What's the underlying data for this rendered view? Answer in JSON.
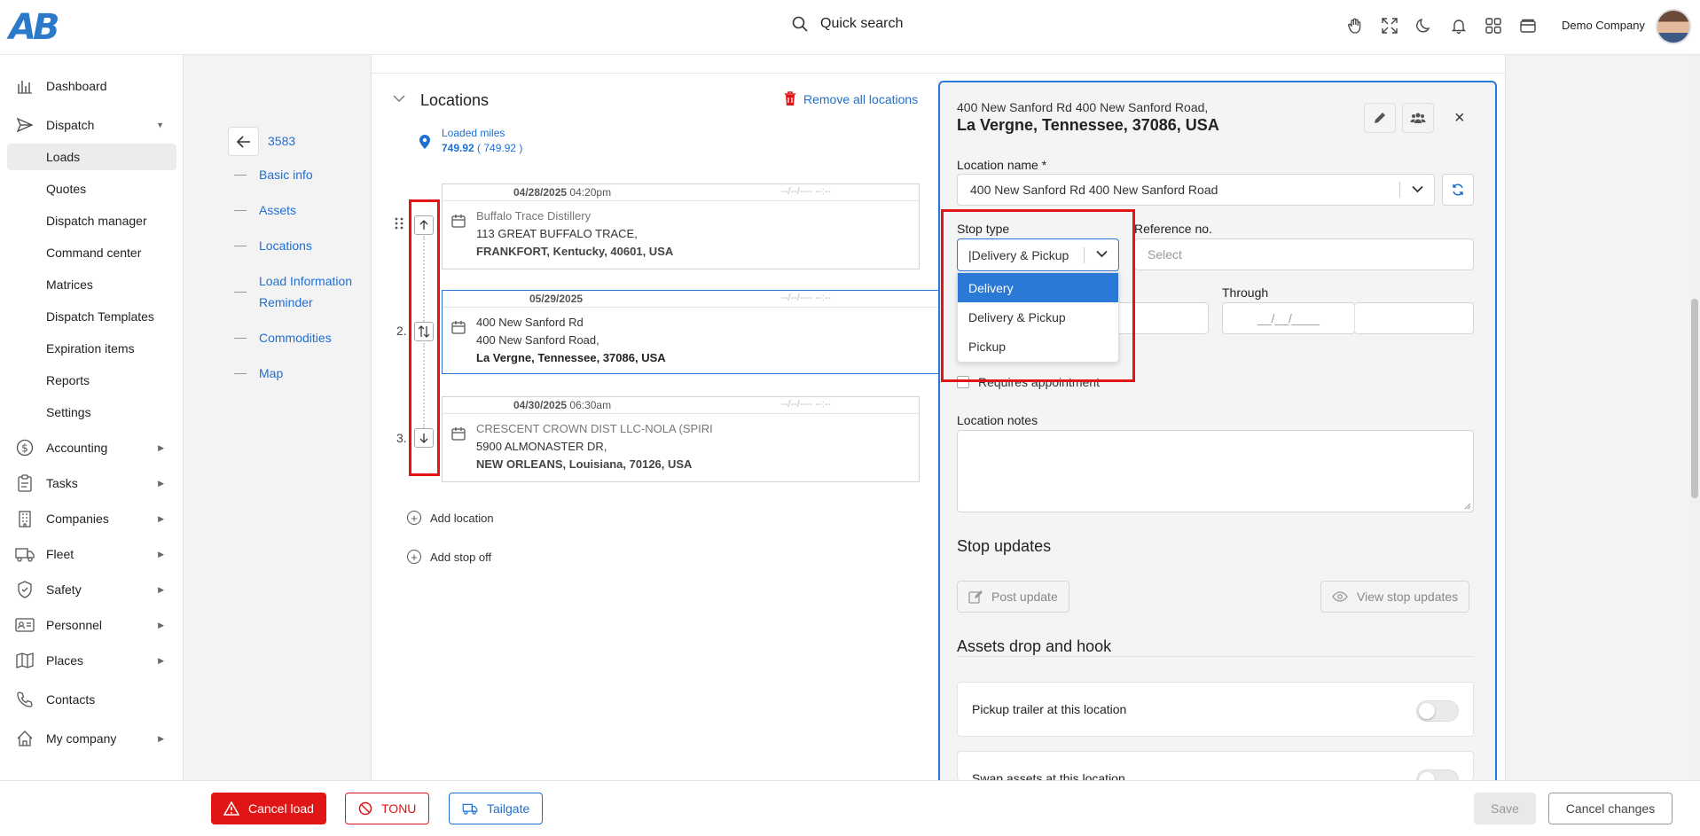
{
  "brand": {
    "logo_text": "AB",
    "accent": "#2b79d6",
    "danger": "#e01515"
  },
  "header": {
    "search_label": "Quick search",
    "company": "Demo Company",
    "icons": [
      "hand-icon",
      "fullscreen-icon",
      "moon-icon",
      "bell-icon",
      "apps-grid-icon",
      "wallet-icon"
    ]
  },
  "sidebar": {
    "items": [
      {
        "label": "Dashboard",
        "icon": "chart-bars-icon"
      },
      {
        "label": "Dispatch",
        "icon": "send-icon",
        "expanded": true
      },
      {
        "label": "Accounting",
        "icon": "dollar-icon"
      },
      {
        "label": "Tasks",
        "icon": "clipboard-icon"
      },
      {
        "label": "Companies",
        "icon": "building-icon"
      },
      {
        "label": "Fleet",
        "icon": "truck-icon"
      },
      {
        "label": "Safety",
        "icon": "shield-icon"
      },
      {
        "label": "Personnel",
        "icon": "id-card-icon"
      },
      {
        "label": "Places",
        "icon": "map-icon"
      },
      {
        "label": "Contacts",
        "icon": "phone-icon"
      },
      {
        "label": "My company",
        "icon": "home-icon"
      }
    ],
    "dispatch_sub": [
      "Loads",
      "Quotes",
      "Dispatch manager",
      "Command center",
      "Matrices",
      "Dispatch Templates",
      "Expiration items",
      "Reports",
      "Settings"
    ]
  },
  "load_nav": {
    "load_number": "3583",
    "sections": [
      "Basic info",
      "Assets",
      "Locations",
      "Load Information",
      "Reminder",
      "Commodities",
      "Map"
    ]
  },
  "locations": {
    "title": "Locations",
    "remove_all": "Remove all locations",
    "loaded_miles_label": "Loaded miles",
    "loaded_miles_value": "749.92",
    "loaded_miles_paren": "( 749.92 )",
    "through_placeholder": "--/--/---- --:--",
    "stops": [
      {
        "num": "",
        "date": "04/28/2025",
        "time": "04:20pm",
        "line1": "Buffalo Trace Distillery",
        "line2": "113 GREAT BUFFALO TRACE,",
        "line3": "FRANKFORT, Kentucky, 40601, USA"
      },
      {
        "num": "2.",
        "date": "05/29/2025",
        "time": "",
        "line1": "400 New Sanford Rd",
        "line2": "400 New Sanford Road,",
        "line3": "La Vergne, Tennessee, 37086, USA"
      },
      {
        "num": "3.",
        "date": "04/30/2025",
        "time": "06:30am",
        "line1": "CRESCENT CROWN DIST LLC-NOLA (SPIRI",
        "line2": "5900 ALMONASTER DR,",
        "line3": "NEW ORLEANS, Louisiana, 70126, USA"
      }
    ],
    "add_location": "Add location",
    "add_stop_off": "Add stop off"
  },
  "form": {
    "addr_line1": "400 New Sanford Rd 400 New Sanford Road,",
    "addr_line2": "La Vergne, Tennessee, 37086, USA",
    "location_name_label": "Location name *",
    "location_name_value": "400 New Sanford Rd 400 New Sanford Road",
    "stop_type_label": "Stop type",
    "stop_type_value": "|Delivery & Pickup",
    "stop_type_options": [
      "Delivery",
      "Delivery & Pickup",
      "Pickup"
    ],
    "reference_label": "Reference no.",
    "reference_placeholder": "Select",
    "through_label": "Through",
    "through_date_placeholder": "__/__/____",
    "requires_appointment": "Requires appointment",
    "location_notes_label": "Location notes",
    "stop_updates_title": "Stop updates",
    "post_update": "Post update",
    "view_stop_updates": "View stop updates",
    "assets_title": "Assets drop and hook",
    "toggle1": "Pickup trailer at this location",
    "toggle2": "Swap assets at this location"
  },
  "footer": {
    "cancel_load": "Cancel load",
    "tonu": "TONU",
    "tailgate": "Tailgate",
    "save": "Save",
    "cancel_changes": "Cancel changes"
  }
}
